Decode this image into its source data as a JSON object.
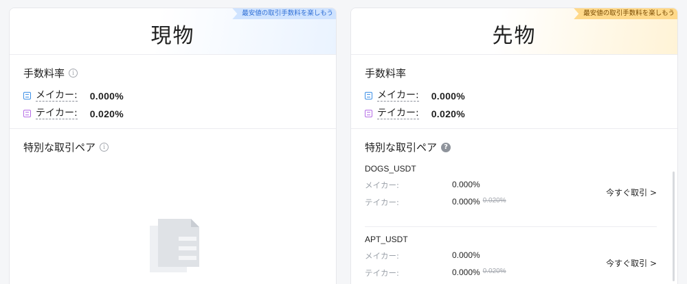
{
  "spot": {
    "title": "現物",
    "promo": "最安値の取引手数料を楽しもう",
    "fee_title": "手数料率",
    "maker_label": "メイカー:",
    "maker_value": "0.000%",
    "taker_label": "テイカー:",
    "taker_value": "0.020%",
    "pairs_title": "特別な取引ペア"
  },
  "futures": {
    "title": "先物",
    "promo": "最安値の取引手数料を楽しもう",
    "fee_title": "手数料率",
    "maker_label": "メイカー:",
    "maker_value": "0.000%",
    "taker_label": "テイカー:",
    "taker_value": "0.020%",
    "pairs_title": "特別な取引ペア",
    "pairs": [
      {
        "name": "DOGS_USDT",
        "maker_label": "メイカー:",
        "maker_value": "0.000%",
        "taker_label": "テイカー:",
        "taker_value": "0.000%",
        "taker_old": "0.020%",
        "action": "今すぐ取引 >"
      },
      {
        "name": "APT_USDT",
        "maker_label": "メイカー:",
        "maker_value": "0.000%",
        "taker_label": "テイカー:",
        "taker_value": "0.000%",
        "taker_old": "0.020%",
        "action": "今すぐ取引 >"
      }
    ]
  },
  "icons": {
    "info": "info-circle-icon",
    "help": "question-circle-icon",
    "maker": "maker-icon",
    "taker": "taker-icon",
    "empty": "empty-document-icon"
  },
  "colors": {
    "spot_ribbon": "#cfe3ff",
    "futures_ribbon": "#ffd98a",
    "maker_icon": "#3a8ee6",
    "taker_icon": "#b46ae6"
  }
}
